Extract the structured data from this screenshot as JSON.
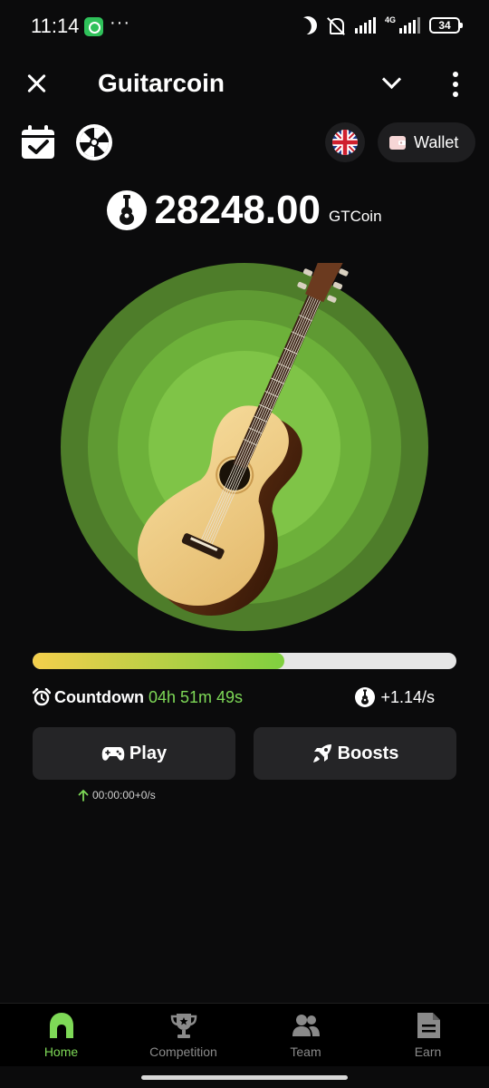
{
  "status_bar": {
    "time": "11:14",
    "more": "···",
    "network": "4G",
    "battery": "34",
    "icons": [
      "whatsapp-icon",
      "moon-icon",
      "mute-icon",
      "wifi-signal-icon",
      "cell-signal-icon",
      "battery-icon"
    ]
  },
  "header": {
    "title": "Guitarcoin",
    "icons": [
      "close-icon",
      "chevron-down-icon",
      "more-vertical-icon"
    ]
  },
  "toolbar": {
    "wallet_label": "Wallet",
    "icons": [
      "calendar-check-icon",
      "fortune-wheel-icon",
      "uk-flag-icon",
      "wallet-icon"
    ]
  },
  "balance": {
    "value": "28248.00",
    "unit": "GTCoin",
    "icon": "guitar-coin-icon"
  },
  "tap_area": {
    "image": "acoustic-guitar",
    "ring_colors": [
      "#4e7d2a",
      "#5f9a33",
      "#6db13a",
      "#7fc447"
    ]
  },
  "energy": {
    "progress": 0.593,
    "fill_colors": [
      "#f4cf4c",
      "#7fd03f"
    ],
    "track_color": "#e6e6e6"
  },
  "countdown": {
    "label": "Countdown",
    "value": "04h 51m 49s",
    "icon": "alarm-clock-icon"
  },
  "rate": {
    "value": "+1.14/s",
    "icon": "guitar-coin-icon"
  },
  "actions": {
    "play_label": "Play",
    "boosts_label": "Boosts",
    "icons": [
      "gamepad-icon",
      "rocket-icon"
    ]
  },
  "play_stat": {
    "text": "00:00:00+0/s",
    "icon": "arrow-up-icon"
  },
  "nav": {
    "items": [
      {
        "label": "Home",
        "icon": "home-icon",
        "active": true
      },
      {
        "label": "Competition",
        "icon": "trophy-icon",
        "active": false
      },
      {
        "label": "Team",
        "icon": "team-icon",
        "active": false
      },
      {
        "label": "Earn",
        "icon": "document-icon",
        "active": false
      }
    ]
  },
  "colors": {
    "background": "#0b0b0c",
    "accent": "#7ed957",
    "button_bg": "#252527",
    "nav_inactive": "#8a8a8a"
  }
}
